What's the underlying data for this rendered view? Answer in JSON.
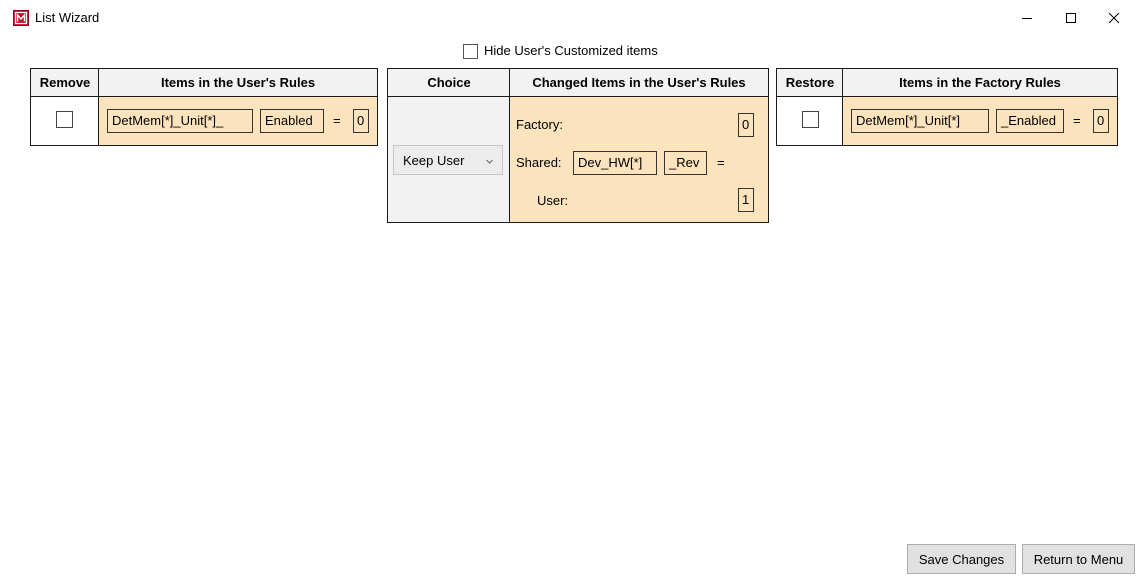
{
  "window": {
    "title": "List Wizard",
    "icon": "app-logo-icon",
    "controls": [
      "minimize-icon",
      "maximize-icon",
      "close-icon"
    ]
  },
  "filter": {
    "hide_customized_label": "Hide User's Customized items",
    "hide_customized_checked": false
  },
  "user_table": {
    "headers": [
      "Remove",
      "Items in the User's Rules"
    ],
    "row": {
      "remove_checked": false,
      "item_name": "DetMem[*]_Unit[*]_",
      "item_attr": "Enabled",
      "equals": "=",
      "value": "0"
    }
  },
  "changed_table": {
    "headers": [
      "Choice",
      "Changed Items in the User's Rules"
    ],
    "choice_value": "Keep User",
    "factory_label": "Factory:",
    "factory_value": "0",
    "shared_label": "Shared:",
    "shared_name": "Dev_HW[*]",
    "shared_attr": "_Rev",
    "shared_equals": "=",
    "user_label": "User:",
    "user_value": "1"
  },
  "factory_table": {
    "headers": [
      "Restore",
      "Items in the Factory Rules"
    ],
    "row": {
      "restore_checked": false,
      "item_name": "DetMem[*]_Unit[*]",
      "item_attr": "_Enabled",
      "equals": "=",
      "value": "0"
    }
  },
  "footer": {
    "save_label": "Save Changes",
    "return_label": "Return to Menu"
  },
  "colors": {
    "cell_tan": "#fbe3bd",
    "header_grey": "#f2f2f2",
    "app_icon_red": "#c8102e"
  }
}
